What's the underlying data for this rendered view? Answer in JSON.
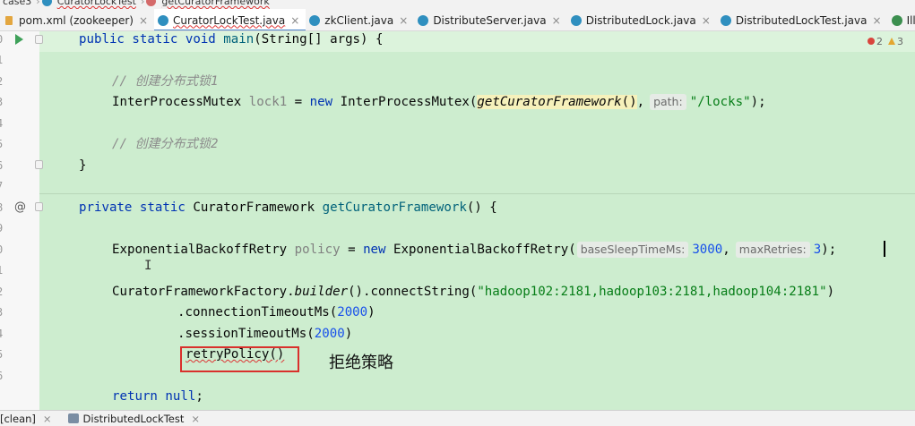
{
  "breadcrumb": {
    "items": [
      "case3",
      "CuratorLockTest",
      "getCuratorFramework"
    ]
  },
  "tabs": [
    {
      "label": "pom.xml (zookeeper)",
      "icon": "xml-file-icon",
      "closable": true
    },
    {
      "label": "CuratorLockTest.java",
      "icon": "class-file-icon",
      "closable": true,
      "active": true
    },
    {
      "label": "zkClient.java",
      "icon": "class-file-icon",
      "closable": true
    },
    {
      "label": "DistributeServer.java",
      "icon": "class-file-icon",
      "closable": true
    },
    {
      "label": "DistributedLock.java",
      "icon": "class-file-icon",
      "closable": true
    },
    {
      "label": "DistributedLockTest.java",
      "icon": "class-file-icon",
      "closable": true
    },
    {
      "label": "IllegalArgumentException",
      "icon": "interface-file-icon",
      "closable": false
    }
  ],
  "tab_close_glyph": "×",
  "gutter": {
    "line_numbers": [
      "0",
      "1",
      "2",
      "3",
      "4",
      "5",
      "6",
      "7",
      "8",
      "9",
      "0",
      "1",
      "2",
      "3",
      "4",
      "5",
      "6"
    ],
    "at_glyph": "@"
  },
  "inspection": {
    "errors": "2",
    "warnings": "3"
  },
  "code": {
    "l0": {
      "kw1": "public",
      "kw2": "static",
      "kw3": "void",
      "name": "main",
      "rest": "(String[] args) {"
    },
    "l2": {
      "comment": "// 创建分布式锁1"
    },
    "l3": {
      "type": "InterProcessMutex",
      "var": "lock1",
      "eq": " = ",
      "kw": "new",
      "ctor": "InterProcessMutex(",
      "call": "getCuratorFramework",
      "call_parens": "()",
      "comma": ",",
      "hint": "path:",
      "str": "\"/locks\"",
      "end": ");"
    },
    "l5": {
      "comment": "// 创建分布式锁2"
    },
    "l6": {
      "text": "}"
    },
    "l8": {
      "kw1": "private",
      "kw2": "static",
      "type": "CuratorFramework",
      "name": "getCuratorFramework",
      "rest": "() {"
    },
    "l10": {
      "type": "ExponentialBackoffRetry",
      "var": "policy",
      "eq": " = ",
      "kw": "new",
      "ctor": "ExponentialBackoffRetry(",
      "hint1": "baseSleepTimeMs:",
      "num1": "3000",
      "comma": ",",
      "hint2": "maxRetries:",
      "num2": "3",
      "end": ");"
    },
    "l12": {
      "cls": "CuratorFrameworkFactory.",
      "method": "builder",
      "mid": "().connectString(",
      "str": "\"hadoop102:2181,hadoop103:2181,hadoop104:2181\"",
      "end": ")"
    },
    "l13": {
      "pre": ".connectionTimeoutMs(",
      "num": "2000",
      "end": ")"
    },
    "l14": {
      "pre": ".sessionTimeoutMs(",
      "num": "2000",
      "end": ")"
    },
    "l15": {
      "text": "retryPolicy()"
    },
    "l17": {
      "kw": "return",
      "kw2": "null",
      "end": ";"
    }
  },
  "annotation": {
    "text": "拒绝策略",
    "box_color": "#d9302c"
  },
  "bottom_tabs": [
    {
      "label": "[clean]",
      "close": "×"
    },
    {
      "label": "DistributedLockTest",
      "close": "×"
    }
  ],
  "colors": {
    "changed_block": "#cdedcf",
    "keyword": "#0033b3",
    "string": "#067d17",
    "number": "#1750eb",
    "comment": "#8c8c8c",
    "method_decl": "#00627a",
    "tab_underline": "#4a86c8"
  }
}
